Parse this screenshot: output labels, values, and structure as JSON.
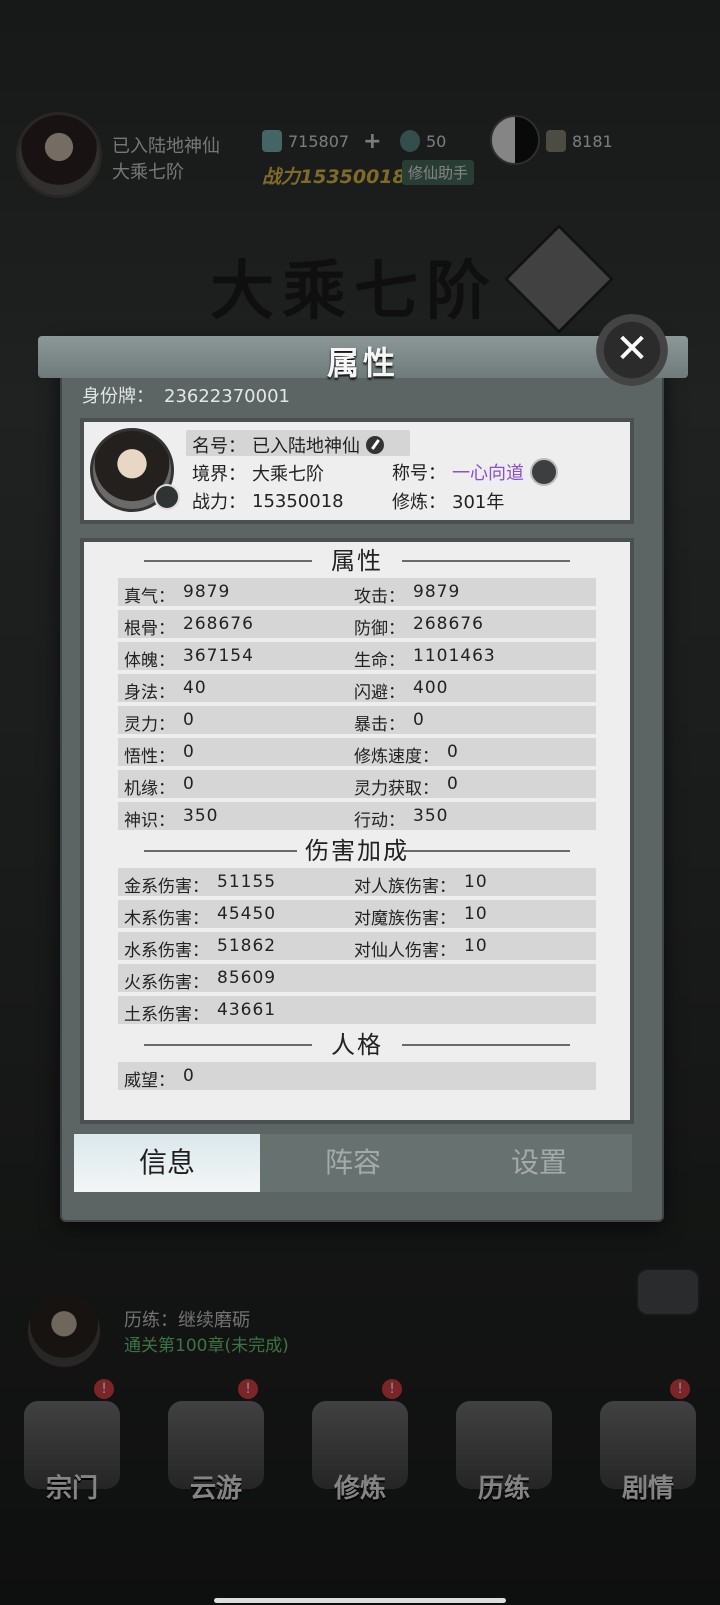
{
  "hud": {
    "player_name": "已入陆地神仙",
    "realm": "大乘七阶",
    "spirit_stones": "715807",
    "jade": "50",
    "scrolls": "8181",
    "power_label": "战力",
    "power_value": "15350018",
    "helper_label": "修仙助手",
    "big_title": "大乘七阶"
  },
  "trial": {
    "title": "历练：继续磨砺",
    "subtitle": "通关第100章(未完成)"
  },
  "nav": [
    {
      "label": "宗门",
      "alert": "!"
    },
    {
      "label": "云游",
      "alert": "!"
    },
    {
      "label": "修炼",
      "alert": "!"
    },
    {
      "label": "历练",
      "alert": ""
    },
    {
      "label": "剧情",
      "alert": "!"
    }
  ],
  "dialog": {
    "title": "属性",
    "close_icon": "close-icon",
    "id_label": "身份牌：",
    "id_value": "23622370001",
    "profile": {
      "name_label": "名号：",
      "name_value": "已入陆地神仙",
      "realm_label": "境界：",
      "realm_value": "大乘七阶",
      "title_label": "称号：",
      "title_value": "一心向道",
      "title_color": "#8b4fcf",
      "power_label": "战力：",
      "power_value": "15350018",
      "cultivation_label": "修炼：",
      "cultivation_value": "301年"
    },
    "attributes": {
      "heading": "属性",
      "rows": [
        [
          {
            "k": "真气：",
            "v": "9879"
          },
          {
            "k": "攻击：",
            "v": "9879"
          }
        ],
        [
          {
            "k": "根骨：",
            "v": "268676"
          },
          {
            "k": "防御：",
            "v": "268676"
          }
        ],
        [
          {
            "k": "体魄：",
            "v": "367154"
          },
          {
            "k": "生命：",
            "v": "1101463"
          }
        ],
        [
          {
            "k": "身法：",
            "v": "40"
          },
          {
            "k": "闪避：",
            "v": "400"
          }
        ],
        [
          {
            "k": "灵力：",
            "v": "0"
          },
          {
            "k": "暴击：",
            "v": "0"
          }
        ],
        [
          {
            "k": "悟性：",
            "v": "0"
          },
          {
            "k": "修炼速度：",
            "v": "0"
          }
        ],
        [
          {
            "k": "机缘：",
            "v": "0"
          },
          {
            "k": "灵力获取：",
            "v": "0"
          }
        ],
        [
          {
            "k": "神识：",
            "v": "350"
          },
          {
            "k": "行动：",
            "v": "350"
          }
        ]
      ]
    },
    "damage": {
      "heading": "伤害加成",
      "rows": [
        [
          {
            "k": "金系伤害：",
            "v": "51155"
          },
          {
            "k": "对人族伤害：",
            "v": "10"
          }
        ],
        [
          {
            "k": "木系伤害：",
            "v": "45450"
          },
          {
            "k": "对魔族伤害：",
            "v": "10"
          }
        ],
        [
          {
            "k": "水系伤害：",
            "v": "51862"
          },
          {
            "k": "对仙人伤害：",
            "v": "10"
          }
        ],
        [
          {
            "k": "火系伤害：",
            "v": "85609"
          },
          {
            "k": "",
            "v": ""
          }
        ],
        [
          {
            "k": "土系伤害：",
            "v": "43661"
          },
          {
            "k": "",
            "v": ""
          }
        ]
      ]
    },
    "personality": {
      "heading": "人格",
      "rows": [
        [
          {
            "k": "威望：",
            "v": "0"
          },
          {
            "k": "",
            "v": ""
          }
        ]
      ]
    },
    "tabs": [
      {
        "label": "信息",
        "active": true
      },
      {
        "label": "阵容",
        "active": false
      },
      {
        "label": "设置",
        "active": false
      }
    ]
  }
}
